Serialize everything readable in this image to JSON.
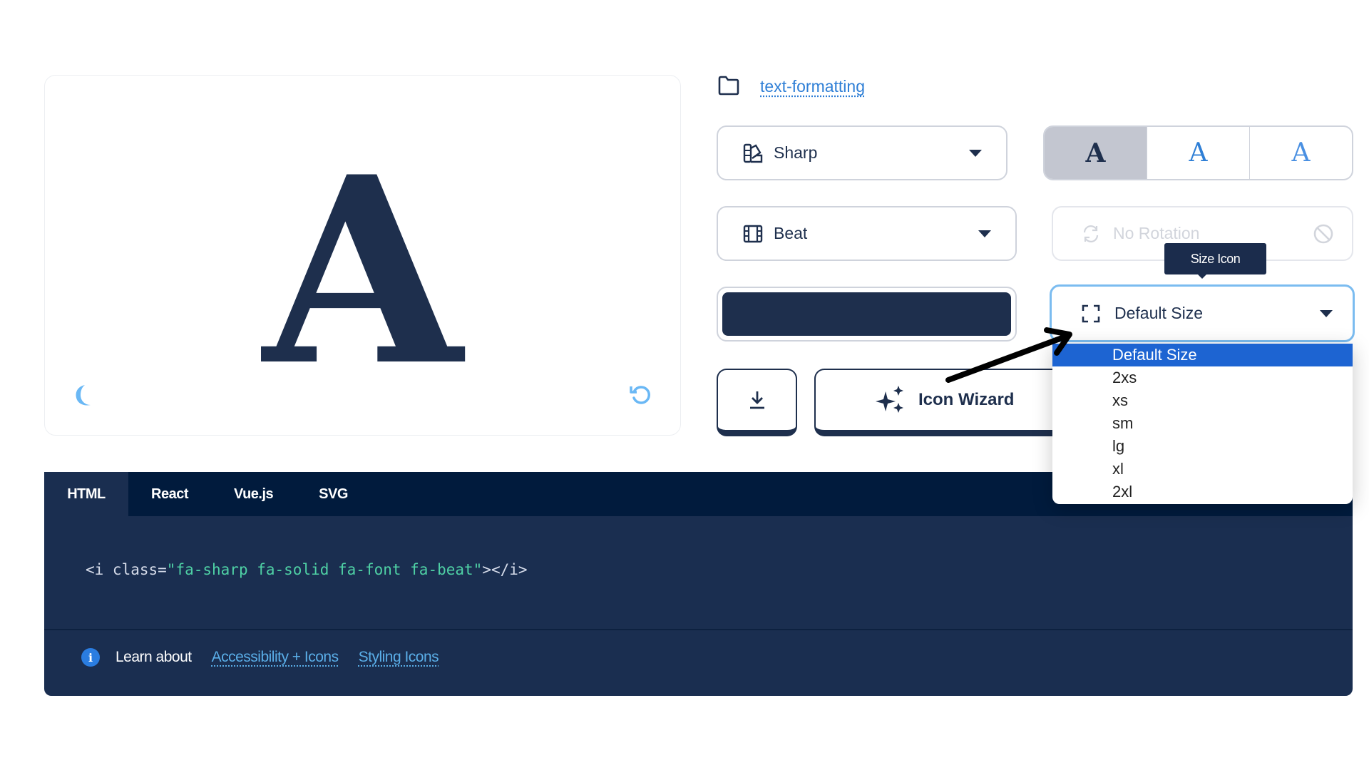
{
  "preview": {
    "glyph": "A",
    "glyph_color": "#1e2f4d",
    "icons": [
      "moon-icon",
      "rotate-left-icon"
    ]
  },
  "category": {
    "icon": "folder-icon",
    "link_label": "text-formatting"
  },
  "controls": {
    "family_style": {
      "icon": "swatchbook-icon",
      "value": "Sharp"
    },
    "weights": [
      {
        "label": "A",
        "name": "solid",
        "selected": true
      },
      {
        "label": "A",
        "name": "regular",
        "selected": false
      },
      {
        "label": "A",
        "name": "light",
        "selected": false
      }
    ],
    "animation": {
      "icon": "film-icon",
      "value": "Beat"
    },
    "rotation": {
      "icon": "arrows-rotate-icon",
      "placeholder": "No Rotation",
      "disabled": true,
      "clear_icon": "ban-icon"
    },
    "color": {
      "value": "#1e2f4d"
    },
    "size": {
      "icon": "expand-icon",
      "value": "Default Size",
      "tooltip": "Size Icon",
      "options": [
        "Default Size",
        "2xs",
        "xs",
        "sm",
        "lg",
        "xl",
        "2xl"
      ],
      "selected_index": 0,
      "open": true
    },
    "download": {
      "icon": "download-icon"
    },
    "wizard": {
      "icon": "sparkles-icon",
      "label": "Icon Wizard"
    }
  },
  "code": {
    "tabs": [
      {
        "label": "HTML",
        "active": true
      },
      {
        "label": "React",
        "active": false
      },
      {
        "label": "Vue.js",
        "active": false
      },
      {
        "label": "SVG",
        "active": false
      }
    ],
    "snippet_prefix": "<i class=",
    "snippet_value": "\"fa-sharp fa-solid fa-font fa-beat\"",
    "snippet_suffix": "></i>"
  },
  "footer": {
    "learn_label": "Learn about",
    "links": [
      "Accessibility + Icons",
      "Styling Icons"
    ]
  },
  "colors": {
    "navy": "#1e2f4d",
    "accent_blue": "#1d64d2",
    "link_blue": "#2f7fd6",
    "code_bg": "#1a2e50",
    "tabbar_bg": "#011b3d",
    "code_string": "#4fd1a5"
  }
}
